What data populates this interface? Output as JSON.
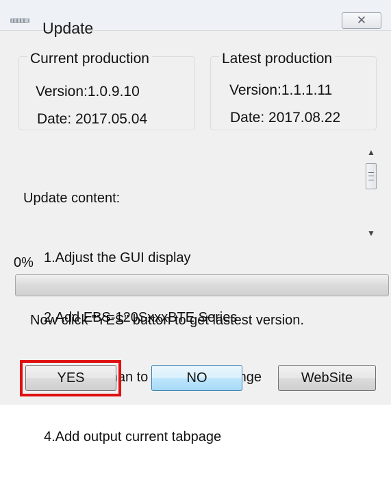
{
  "window": {
    "title": "Update",
    "close_icon": "close-icon",
    "app_icon": "app-icon"
  },
  "current": {
    "heading": "Current production",
    "version": "Version:1.0.9.10",
    "date": "Date: 2017.05.04"
  },
  "latest": {
    "heading": "Latest production",
    "version": "Version:1.1.1.11",
    "date": "Date: 2017.08.22"
  },
  "content": {
    "heading": "Update content:",
    "items": [
      "1.Adjust the GUI display",
      "2.Add EBS-120SxxxBTE Series",
      "3.Add German to Language change",
      "4.Add output current tabpage"
    ]
  },
  "progress": {
    "label": "0%",
    "value": 0
  },
  "instruction": "Now click \"YES\" button to get lastest version.",
  "buttons": {
    "yes": "YES",
    "no": "NO",
    "website": "WebSite"
  },
  "colors": {
    "highlight": "#e01010"
  }
}
